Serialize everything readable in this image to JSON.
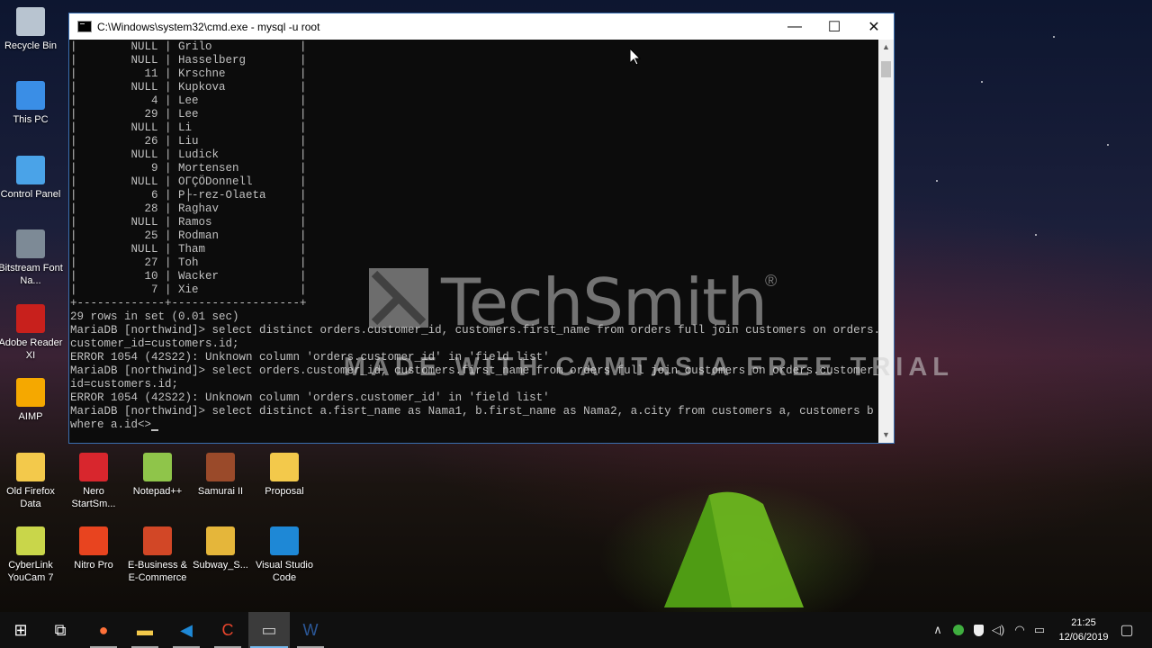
{
  "window": {
    "title": "C:\\Windows\\system32\\cmd.exe - mysql  -u root",
    "minimize_symbol": "—",
    "maximize_symbol": "☐",
    "close_symbol": "✕"
  },
  "console_lines": [
    "|        NULL | Grilo             |",
    "|        NULL | Hasselberg        |",
    "|          11 | Krschne           |",
    "|        NULL | Kupkova           |",
    "|           4 | Lee               |",
    "|          29 | Lee               |",
    "|        NULL | Li                |",
    "|          26 | Liu               |",
    "|        NULL | Ludick            |",
    "|           9 | Mortensen         |",
    "|        NULL | OΓÇÖDonnell       |",
    "|           6 | P├-rez-Olaeta     |",
    "|          28 | Raghav            |",
    "|        NULL | Ramos             |",
    "|          25 | Rodman            |",
    "|        NULL | Tham              |",
    "|          27 | Toh               |",
    "|          10 | Wacker            |",
    "|           7 | Xie               |",
    "+-------------+-------------------+",
    "29 rows in set (0.01 sec)",
    "",
    "MariaDB [northwind]> select distinct orders.customer_id, customers.first_name from orders full join customers on orders.",
    "customer_id=customers.id;",
    "ERROR 1054 (42S22): Unknown column 'orders.customer_id' in 'field list'",
    "MariaDB [northwind]> select orders.customer_id, customers.first_name from orders full join customers on orders.customer_",
    "id=customers.id;",
    "ERROR 1054 (42S22): Unknown column 'orders.customer_id' in 'field list'",
    "MariaDB [northwind]> select distinct a.fisrt_name as Nama1, b.first_name as Nama2, a.city from customers a, customers b",
    "where a.id<>"
  ],
  "watermark": {
    "brand": "TechSmith",
    "registered": "®",
    "trial_text": "MADE WITH CAMTASIA FREE TRIAL"
  },
  "desktop_icons": [
    {
      "label": "Recycle Bin",
      "icon": "recycle-bin-icon",
      "color": "#b8c4d0"
    },
    {
      "label": "This PC",
      "icon": "computer-icon",
      "color": "#3a8ee6"
    },
    {
      "label": "Control Panel",
      "icon": "control-panel-icon",
      "color": "#4aa3e8"
    },
    {
      "label": "Bitstream Font Na...",
      "icon": "font-navigator-icon",
      "color": "#7d8a96"
    },
    {
      "label": "Adobe Reader XI",
      "icon": "adobe-reader-icon",
      "color": "#c8201c"
    },
    {
      "label": "AIMP",
      "icon": "aimp-icon",
      "color": "#f5a800"
    },
    {
      "label": "Old Firefox Data",
      "icon": "folder-icon",
      "color": "#f3c94b"
    },
    {
      "label": "Nero StartSm...",
      "icon": "nero-icon",
      "color": "#d8262d"
    },
    {
      "label": "Notepad++",
      "icon": "notepad-plus-plus-icon",
      "color": "#8fc54a"
    },
    {
      "label": "Samurai II",
      "icon": "samurai-game-icon",
      "color": "#9a4a2a"
    },
    {
      "label": "Proposal",
      "icon": "folder-icon",
      "color": "#f3c94b"
    },
    {
      "label": "CyberLink YouCam 7",
      "icon": "youcam-icon",
      "color": "#c9d64a"
    },
    {
      "label": "Nitro Pro",
      "icon": "nitro-pro-icon",
      "color": "#e8441f"
    },
    {
      "label": "E-Business & E-Commerce",
      "icon": "powerpoint-file-icon",
      "color": "#d24726"
    },
    {
      "label": "Subway_S...",
      "icon": "subway-surfers-icon",
      "color": "#e5b63a"
    },
    {
      "label": "Visual Studio Code",
      "icon": "vscode-icon",
      "color": "#1e88d6"
    }
  ],
  "taskbar": {
    "apps": [
      {
        "name": "start-button",
        "glyph": "⊞",
        "color": "#ffffff"
      },
      {
        "name": "task-view-button",
        "glyph": "⧉",
        "color": "#ffffff"
      },
      {
        "name": "firefox-icon",
        "glyph": "●",
        "color": "#ff7139"
      },
      {
        "name": "file-explorer-icon",
        "glyph": "▬",
        "color": "#f3c94b"
      },
      {
        "name": "vscode-icon",
        "glyph": "◀",
        "color": "#1e88d6"
      },
      {
        "name": "camtasia-icon",
        "glyph": "C",
        "color": "#e8452c"
      },
      {
        "name": "cmd-icon",
        "glyph": "▭",
        "color": "#cccccc"
      },
      {
        "name": "word-icon",
        "glyph": "W",
        "color": "#2b5797"
      }
    ],
    "tray": {
      "chevron": "∧",
      "wifi": "◠",
      "volume": "◁)",
      "battery": "▭",
      "action_center": "▢"
    },
    "time": "21:25",
    "date": "12/06/2019"
  }
}
